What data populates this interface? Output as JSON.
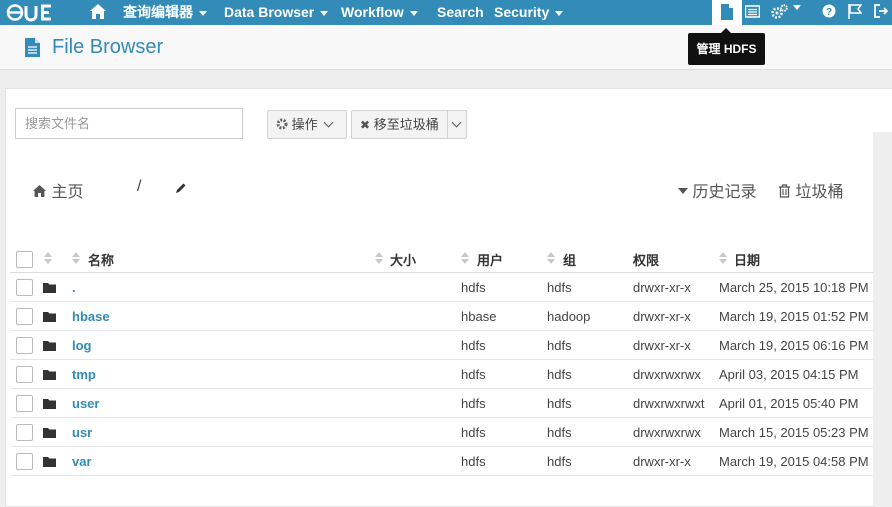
{
  "nav": {
    "logo": "HUE",
    "items": [
      {
        "label": "查询编辑器",
        "caret": true
      },
      {
        "label": "Data Browser",
        "caret": true
      },
      {
        "label": "Workflow",
        "caret": true
      },
      {
        "label": "Search",
        "caret": false
      },
      {
        "label": "Security",
        "caret": true
      }
    ]
  },
  "tooltip": "管理 HDFS",
  "header": {
    "title": "File Browser"
  },
  "toolbar": {
    "search_placeholder": "搜索文件名",
    "actions_label": "操作",
    "trash_label": "移至垃圾桶"
  },
  "breadcrumb": {
    "home": "主页",
    "separator": "/"
  },
  "links": {
    "history": "历史记录",
    "trash": "垃圾桶"
  },
  "table": {
    "columns": {
      "name": "名称",
      "size": "大小",
      "user": "用户",
      "group": "组",
      "permissions": "权限",
      "date": "日期"
    },
    "rows": [
      {
        "name": ".",
        "size": "",
        "user": "hdfs",
        "group": "hdfs",
        "permissions": "drwxr-xr-x",
        "date": "March 25, 2015 10:18 PM"
      },
      {
        "name": "hbase",
        "size": "",
        "user": "hbase",
        "group": "hadoop",
        "permissions": "drwxr-xr-x",
        "date": "March 19, 2015 01:52 PM"
      },
      {
        "name": "log",
        "size": "",
        "user": "hdfs",
        "group": "hdfs",
        "permissions": "drwxr-xr-x",
        "date": "March 19, 2015 06:16 PM"
      },
      {
        "name": "tmp",
        "size": "",
        "user": "hdfs",
        "group": "hdfs",
        "permissions": "drwxrwxrwx",
        "date": "April 03, 2015 04:15 PM"
      },
      {
        "name": "user",
        "size": "",
        "user": "hdfs",
        "group": "hdfs",
        "permissions": "drwxrwxrwxt",
        "date": "April 01, 2015 05:40 PM"
      },
      {
        "name": "usr",
        "size": "",
        "user": "hdfs",
        "group": "hdfs",
        "permissions": "drwxrwxrwx",
        "date": "March 15, 2015 05:23 PM"
      },
      {
        "name": "var",
        "size": "",
        "user": "hdfs",
        "group": "hdfs",
        "permissions": "drwxr-xr-x",
        "date": "March 19, 2015 04:58 PM"
      }
    ]
  },
  "colors": {
    "brand": "#338bb8",
    "nav_bg": "#338bb8",
    "link": "#338bb8"
  }
}
